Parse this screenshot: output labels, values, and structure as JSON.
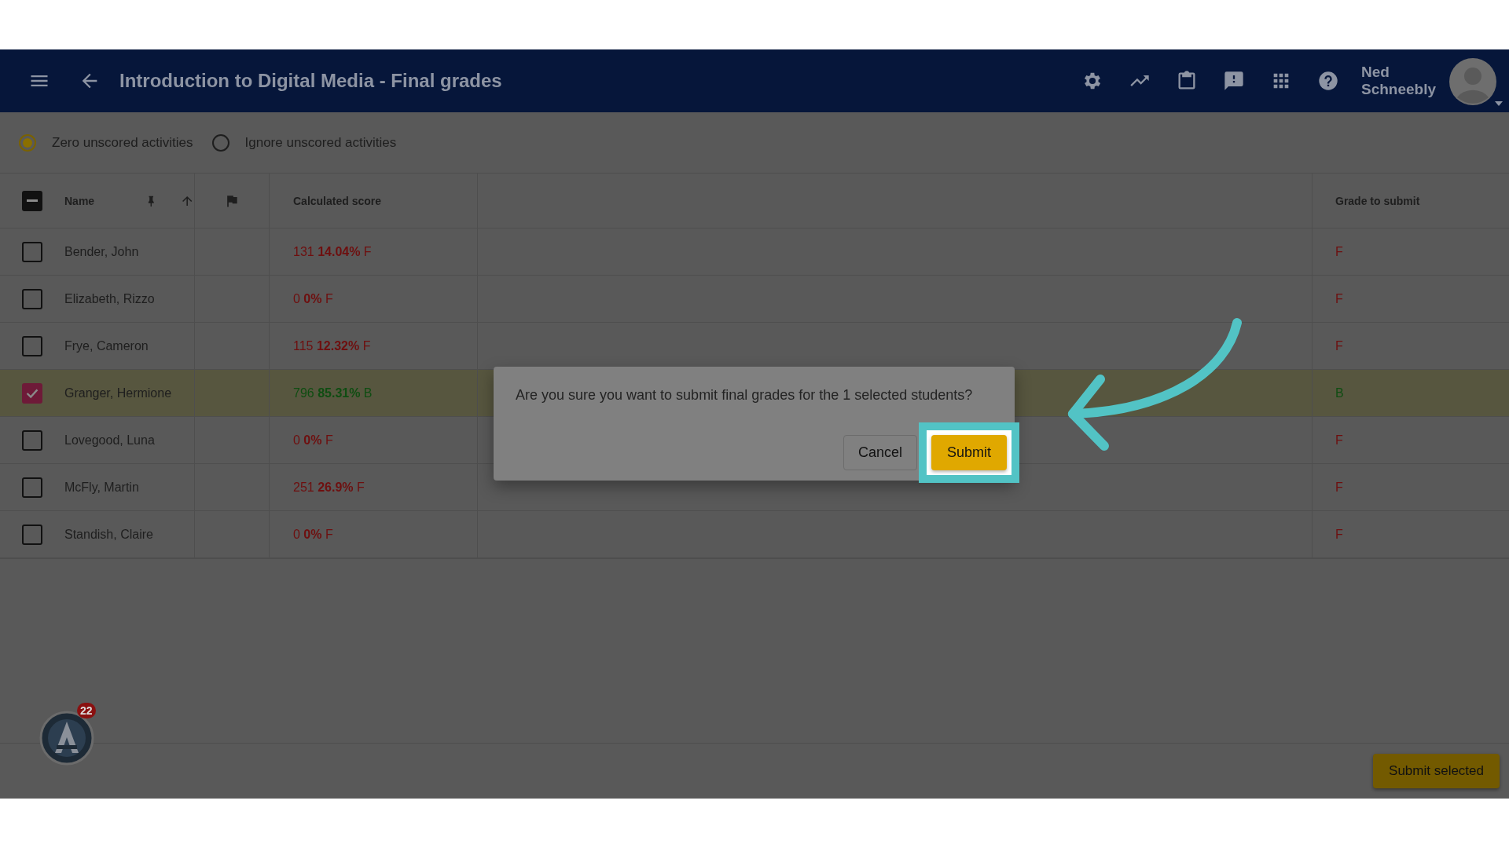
{
  "header": {
    "title": "Introduction to Digital Media - Final grades",
    "user_name": "Ned Schneebly"
  },
  "scoring_options": [
    {
      "label": "Zero unscored activities",
      "selected": true
    },
    {
      "label": "Ignore unscored activities",
      "selected": false
    }
  ],
  "table": {
    "select_all": {
      "indeterminate": true
    },
    "columns": {
      "name": "Name",
      "calculated_score": "Calculated score",
      "grade": "Grade to submit"
    },
    "rows": [
      {
        "name": "Bender, John",
        "score": "131 **14.04%** F",
        "grade": "F",
        "kind": "fail",
        "checked": false
      },
      {
        "name": "Elizabeth, Rizzo",
        "score": "0 **0%** F",
        "grade": "F",
        "kind": "fail",
        "checked": false
      },
      {
        "name": "Frye, Cameron",
        "score": "115 **12.32%** F",
        "grade": "F",
        "kind": "fail",
        "checked": false
      },
      {
        "name": "Granger, Hermione",
        "score": "796 **85.31%** B",
        "grade": "B",
        "kind": "pass",
        "checked": true
      },
      {
        "name": "Lovegood, Luna",
        "score": "0 **0%** F",
        "grade": "F",
        "kind": "fail",
        "checked": false
      },
      {
        "name": "McFly, Martin",
        "score": "251 **26.9%** F",
        "grade": "F",
        "kind": "fail",
        "checked": false
      },
      {
        "name": "Standish, Claire",
        "score": "0 **0%** F",
        "grade": "F",
        "kind": "fail",
        "checked": false
      }
    ]
  },
  "dialog": {
    "message": "Are you sure you want to submit final grades for the 1 selected students?",
    "buttons": [
      {
        "label": "Cancel",
        "kind": "secondary",
        "highlighted": false
      },
      {
        "label": "Submit",
        "kind": "primary",
        "highlighted": true
      }
    ]
  },
  "notification_badge": "22",
  "footer": {
    "button": "Submit selected"
  }
}
